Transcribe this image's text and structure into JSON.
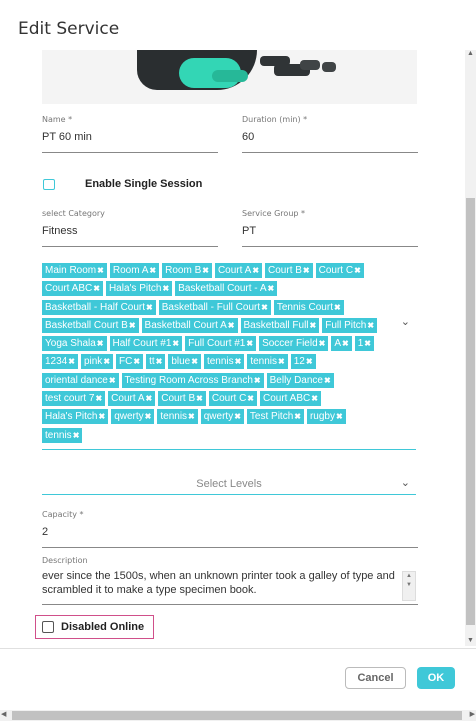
{
  "dialog": {
    "title": "Edit Service"
  },
  "fields": {
    "name": {
      "label": "Name *",
      "value": "PT 60 min"
    },
    "duration": {
      "label": "Duration (min) *",
      "value": "60"
    },
    "category": {
      "label": "select Category",
      "value": "Fitness"
    },
    "service_group": {
      "label": "Service Group *",
      "value": "PT"
    },
    "capacity": {
      "label": "Capacity *",
      "value": "2"
    },
    "description": {
      "label": "Description",
      "value": "ever since the 1500s, when an unknown printer took a galley of type and scrambled it to make a type specimen book."
    }
  },
  "single_session": {
    "label": "Enable Single Session",
    "checked": false
  },
  "courts": {
    "tags": [
      "Main Room",
      "Room A",
      "Room B",
      "Court A",
      "Court B",
      "Court C",
      "Court ABC",
      "Hala's Pitch",
      "Basketball Court - A",
      "Basketball - Half Court",
      "Basketball - Full Court",
      "Tennis Court",
      "Basketball Court B",
      "Basketball Court A",
      "Basketball Full",
      "Full Pitch",
      "Yoga Shala",
      "Half Court #1",
      "Full Court #1",
      "Soccer Field",
      "A",
      "1",
      "1234",
      "pink",
      "FC",
      "tt",
      "blue",
      "tennis",
      "tennis",
      "12",
      "oriental dance",
      "Testing Room Across Branch",
      "Belly Dance",
      "test court 7",
      "Court A",
      "Court B",
      "Court C",
      "Court ABC",
      "Hala's Pitch",
      "qwerty",
      "tennis",
      "qwerty",
      "Test Pitch",
      "rugby",
      "tennis"
    ],
    "remove_glyph": "✖",
    "chevron": "⌄"
  },
  "levels": {
    "placeholder": "Select Levels",
    "chevron": "⌄"
  },
  "disabled_online": {
    "label": "Disabled Online",
    "checked": false
  },
  "buttons": {
    "cancel": "Cancel",
    "ok": "OK"
  },
  "colors": {
    "accent": "#3fc8d8",
    "highlight_border": "#d04f8a"
  }
}
